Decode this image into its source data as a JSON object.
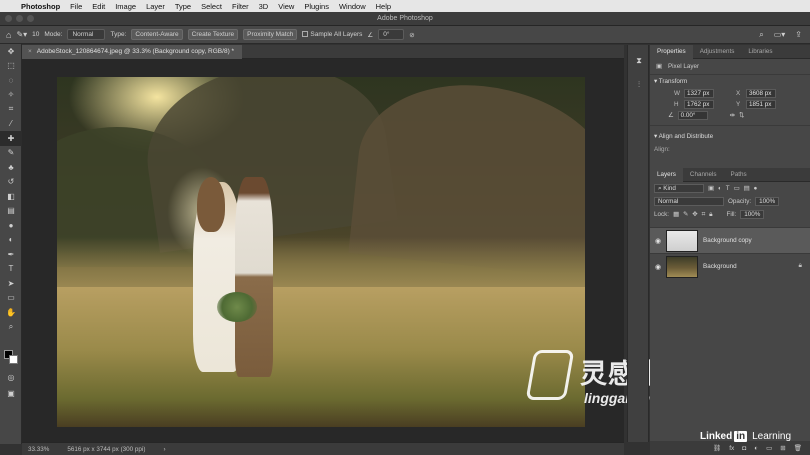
{
  "menubar": {
    "items": [
      "Photoshop",
      "File",
      "Edit",
      "Image",
      "Layer",
      "Type",
      "Select",
      "Filter",
      "3D",
      "View",
      "Plugins",
      "Window",
      "Help"
    ]
  },
  "titlebar": {
    "title": "Adobe Photoshop"
  },
  "options": {
    "brush_size": "10",
    "mode_label": "Mode:",
    "mode_value": "Normal",
    "type_label": "Type:",
    "type_content_aware": "Content-Aware",
    "type_create_texture": "Create Texture",
    "type_proximity_match": "Proximity Match",
    "sample_all_layers": "Sample All Layers",
    "angle_value": "0°"
  },
  "document": {
    "tab_title": "AdobeStock_120864674.jpeg @ 33.3% (Background copy, RGB/8) *"
  },
  "status": {
    "zoom": "33.33%",
    "doc_info": "5616 px x 3744 px (300 ppi)"
  },
  "panels": {
    "top_tabs": [
      "Properties",
      "Adjustments",
      "Libraries"
    ],
    "pixel_layer": "Pixel Layer",
    "transform_header": "Transform",
    "w_label": "W",
    "w_value": "1327 px",
    "h_label": "H",
    "h_value": "1762 px",
    "x_label": "X",
    "x_value": "3608 px",
    "y_label": "Y",
    "y_value": "1851 px",
    "angle_value": "0.00°",
    "align_header": "Align and Distribute",
    "align_label": "Align:",
    "layer_tabs": [
      "Layers",
      "Channels",
      "Paths"
    ],
    "kind_label": "Kind",
    "blend_mode": "Normal",
    "opacity_label": "Opacity:",
    "opacity_value": "100%",
    "lock_label": "Lock:",
    "fill_label": "Fill:",
    "fill_value": "100%",
    "layers": [
      {
        "name": "Background copy",
        "selected": true
      },
      {
        "name": "Background",
        "selected": false
      }
    ]
  },
  "watermark": {
    "cn": "灵感中国",
    "en": "lingganchina.com"
  },
  "branding": {
    "linkedin": "Linked",
    "in": "in",
    "learning": "Learning"
  },
  "colors": {
    "foreground": "#000000",
    "background": "#ffffff"
  }
}
